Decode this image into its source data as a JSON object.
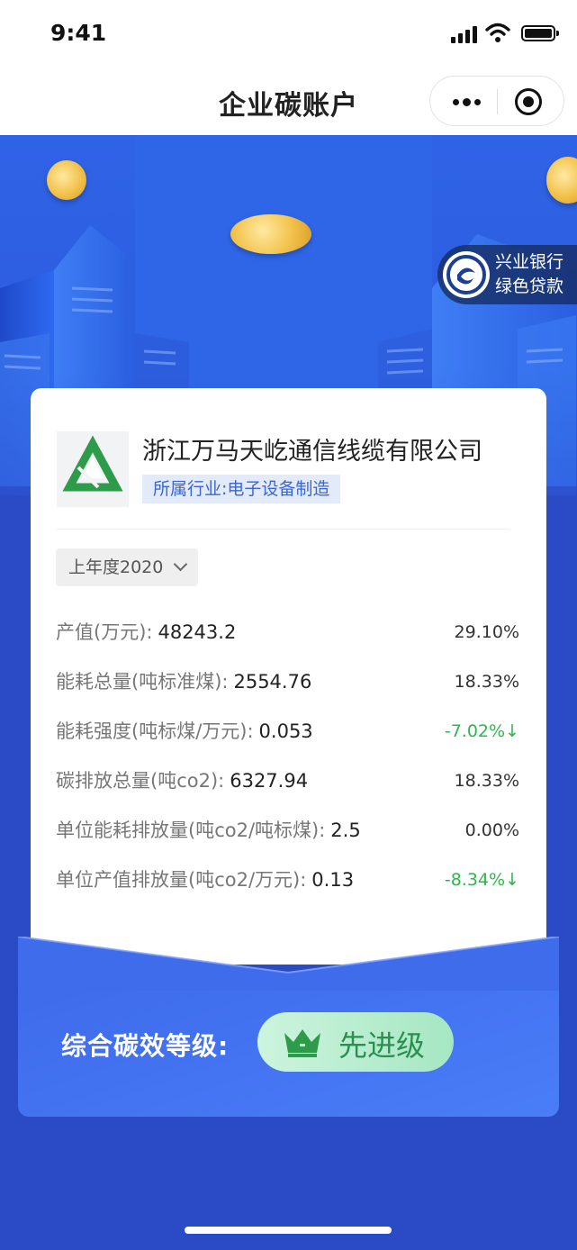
{
  "status_bar": {
    "time": "9:41"
  },
  "nav": {
    "title": "企业碳账户"
  },
  "bank_badge": {
    "line1": "兴业银行",
    "line2": "绿色贷款"
  },
  "company": {
    "name": "浙江万马天屹通信线缆有限公司",
    "industry": "所属行业:电子设备制造"
  },
  "year_select": {
    "label": "上年度2020"
  },
  "metrics": [
    {
      "label": "产值(万元):",
      "value": "48243.2",
      "change": "29.10%"
    },
    {
      "label": "能耗总量(吨标准煤):",
      "value": "2554.76",
      "change": "18.33%"
    },
    {
      "label": "能耗强度(吨标煤/万元):",
      "value": "0.053",
      "change": "-7.02%↓"
    },
    {
      "label": "碳排放总量(吨co2):",
      "value": "6327.94",
      "change": "18.33%"
    },
    {
      "label": "单位能耗排放量(吨co2/吨标煤):",
      "value": "2.5",
      "change": "0.00%"
    },
    {
      "label": "单位产值排放量(吨co2/万元):",
      "value": "0.13",
      "change": "-8.34%↓"
    }
  ],
  "grade": {
    "label": "综合碳效等级:",
    "value": "先进级"
  },
  "colors": {
    "primary": "#2f63e6",
    "positive_green": "#2fb64d",
    "grade_green": "#2a8f4f"
  }
}
